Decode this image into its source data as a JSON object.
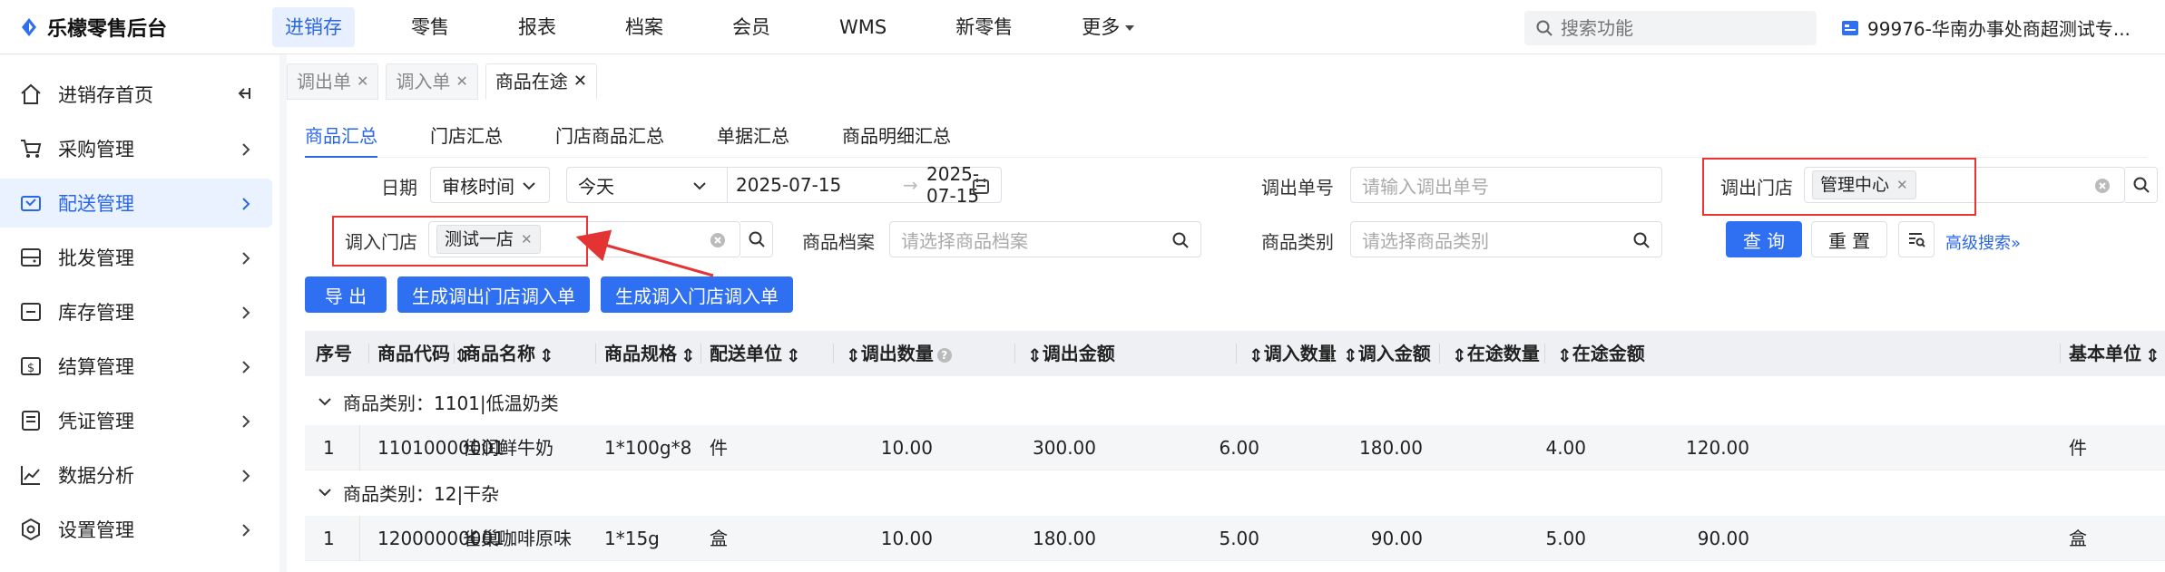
{
  "brand": {
    "title": "乐檬零售后台"
  },
  "topnav": [
    {
      "label": "进销存",
      "active": true
    },
    {
      "label": "零售"
    },
    {
      "label": "报表"
    },
    {
      "label": "档案"
    },
    {
      "label": "会员"
    },
    {
      "label": "WMS"
    },
    {
      "label": "新零售"
    },
    {
      "label": "更多"
    }
  ],
  "search": {
    "placeholder": "搜索功能"
  },
  "store": {
    "label": "99976-华南办事处商超测试专..."
  },
  "sidebar": {
    "items": [
      {
        "label": "进销存首页",
        "icon": "home-icon"
      },
      {
        "label": "采购管理",
        "icon": "cart-icon"
      },
      {
        "label": "配送管理",
        "icon": "delivery-icon",
        "active": true
      },
      {
        "label": "批发管理",
        "icon": "wholesale-icon"
      },
      {
        "label": "库存管理",
        "icon": "inventory-icon"
      },
      {
        "label": "结算管理",
        "icon": "settlement-icon"
      },
      {
        "label": "凭证管理",
        "icon": "voucher-icon"
      },
      {
        "label": "数据分析",
        "icon": "analytics-icon"
      },
      {
        "label": "设置管理",
        "icon": "settings-icon"
      }
    ]
  },
  "tabs": [
    {
      "label": "调出单"
    },
    {
      "label": "调入单"
    },
    {
      "label": "商品在途",
      "active": true
    }
  ],
  "subtabs": [
    {
      "label": "商品汇总",
      "active": true
    },
    {
      "label": "门店汇总"
    },
    {
      "label": "门店商品汇总"
    },
    {
      "label": "单据汇总"
    },
    {
      "label": "商品明细汇总"
    }
  ],
  "filters": {
    "date_label": "日期",
    "date_type": "审核时间",
    "date_range": "今天",
    "date_start": "2025-07-15",
    "date_end": "2025-07-15",
    "out_no_label": "调出单号",
    "out_no_placeholder": "请输入调出单号",
    "out_store_label": "调出门店",
    "out_store_tag": "管理中心",
    "in_store_label": "调入门店",
    "in_store_tag": "测试一店",
    "goods_label": "商品档案",
    "goods_placeholder": "请选择商品档案",
    "category_label": "商品类别",
    "category_placeholder": "请选择商品类别"
  },
  "buttons": {
    "query": "查 询",
    "reset": "重 置",
    "advanced": "高级搜索",
    "export": "导 出",
    "gen_out": "生成调出门店调入单",
    "gen_in": "生成调入门店调入单"
  },
  "table": {
    "columns": [
      "序号",
      "商品代码",
      "商品名称",
      "商品规格",
      "配送单位",
      "调出数量",
      "调出金额",
      "调入数量",
      "调入金额",
      "在途数量",
      "在途金额",
      "基本单位"
    ],
    "groups": [
      {
        "title": "商品类别：1101|低温奶类",
        "rows": [
          [
            "1",
            "11010000001",
            "佳润鲜牛奶",
            "1*100g*8",
            "件",
            "10.00",
            "300.00",
            "6.00",
            "180.00",
            "4.00",
            "120.00",
            "件"
          ]
        ]
      },
      {
        "title": "商品类别：12|干杂",
        "rows": [
          [
            "1",
            "12000000001",
            "雀巢咖啡原味",
            "1*15g",
            "盒",
            "10.00",
            "180.00",
            "5.00",
            "90.00",
            "5.00",
            "90.00",
            "盒"
          ]
        ]
      }
    ]
  },
  "colors": {
    "primary": "#2f6ff2",
    "highlight": "#e33333",
    "active_bg": "#eaf1ff"
  }
}
